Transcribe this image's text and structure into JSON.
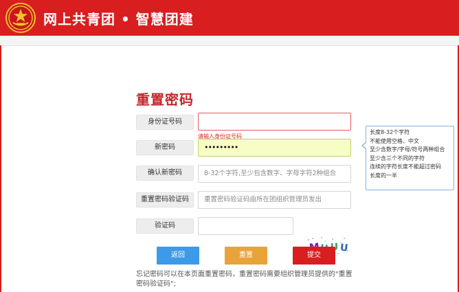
{
  "header": {
    "title": "网上共青团 • 智慧团建",
    "logo_icon": "youth-league-emblem-icon",
    "brand_color": "#d81e1e"
  },
  "form": {
    "title": "重置密码",
    "title_color": "#c0282c",
    "fields": [
      {
        "label": "身份证号码",
        "value": "",
        "placeholder": "",
        "error": "请输入身份证号码"
      },
      {
        "label": "新密码",
        "value": "•••••••••",
        "placeholder": ""
      },
      {
        "label": "确认新密码",
        "value": "",
        "placeholder": "8-32个字符,至少包含数字、字母字符2种组合"
      },
      {
        "label": "重置密码验证码",
        "value": "",
        "placeholder": "重置密码验证码由所在团组织管理员发出"
      },
      {
        "label": "验证码",
        "value": "",
        "placeholder": ""
      }
    ],
    "captcha_text": "MUUU"
  },
  "tooltip": {
    "lines": [
      "长度8-32个字符",
      "不能使用空格、中文",
      "至少含数字/字母/符号两种组合",
      "至少含三个不同的字符",
      "连续的字符长度不能超过密码",
      "长度的一半"
    ]
  },
  "buttons": {
    "back": "返回",
    "reset": "重置",
    "submit": "提交",
    "back_color": "#3d9ae8",
    "reset_color": "#e8a33a",
    "submit_color": "#d81e1e"
  },
  "note": "忘记密码可以在本页面重置密码，重置密码需要组织管理员提供的\"重置密码验证码\";"
}
